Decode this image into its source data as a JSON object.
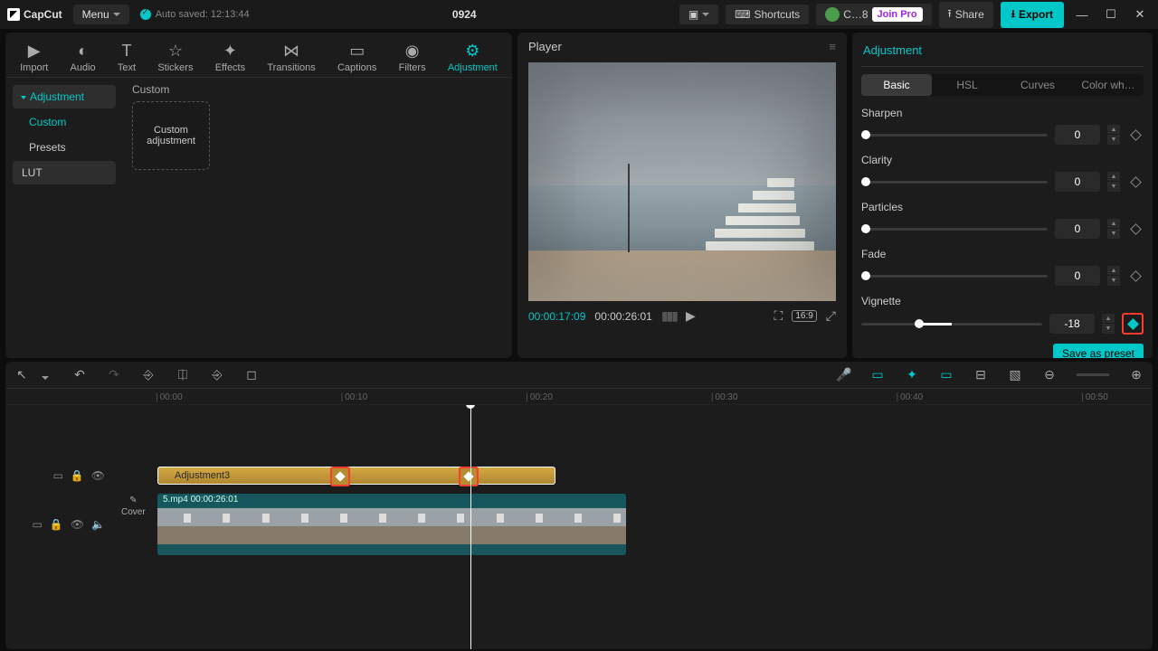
{
  "titlebar": {
    "brand": "CapCut",
    "menu": "Menu",
    "autosave": "Auto saved: 12:13:44",
    "project": "0924",
    "shortcuts": "Shortcuts",
    "user": "C…8",
    "join_pro": "Join Pro",
    "share": "Share",
    "export": "Export"
  },
  "media_tabs": [
    {
      "label": "Import",
      "icon": "▶"
    },
    {
      "label": "Audio",
      "icon": "◐"
    },
    {
      "label": "Text",
      "icon": "T"
    },
    {
      "label": "Stickers",
      "icon": "☆"
    },
    {
      "label": "Effects",
      "icon": "✦"
    },
    {
      "label": "Transitions",
      "icon": "⋈"
    },
    {
      "label": "Captions",
      "icon": "▭"
    },
    {
      "label": "Filters",
      "icon": "◉"
    },
    {
      "label": "Adjustment",
      "icon": "⚙"
    }
  ],
  "media_side": {
    "adjustment": "Adjustment",
    "custom": "Custom",
    "presets": "Presets",
    "lut": "LUT"
  },
  "media_body": {
    "category": "Custom",
    "tile": "Custom adjustment"
  },
  "player": {
    "title": "Player",
    "current": "00:00:17:09",
    "total": "00:00:26:01",
    "aspect": "16:9"
  },
  "adjust": {
    "title": "Adjustment",
    "tabs": [
      "Basic",
      "HSL",
      "Curves",
      "Color wh…"
    ],
    "rows": [
      {
        "label": "Sharpen",
        "value": "0",
        "pos": 0,
        "kf": false
      },
      {
        "label": "Clarity",
        "value": "0",
        "pos": 0,
        "kf": false
      },
      {
        "label": "Particles",
        "value": "0",
        "pos": 0,
        "kf": false
      },
      {
        "label": "Fade",
        "value": "0",
        "pos": 0,
        "kf": false
      },
      {
        "label": "Vignette",
        "value": "-18",
        "pos": 32,
        "kf": true,
        "highlight": true,
        "center": true
      }
    ],
    "save_preset": "Save as preset"
  },
  "timeline": {
    "ruler": [
      "00:00",
      "00:10",
      "00:20",
      "00:30",
      "00:40",
      "00:50"
    ],
    "adjust_clip": "Adjustment3",
    "video_clip": "5.mp4  00:00:26:01",
    "cover": "Cover"
  }
}
